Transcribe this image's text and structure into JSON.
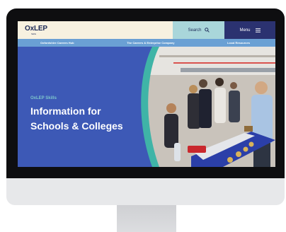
{
  "site": {
    "logo_text": "OxLEP",
    "logo_sub": "Skills"
  },
  "header": {
    "search_label": "Search",
    "menu_label": "Menu"
  },
  "subnav": {
    "items": [
      {
        "label": "Oxfordshire Careers Hub"
      },
      {
        "label": "The Careers & Enterprise Company"
      },
      {
        "label": "Local Resources"
      }
    ]
  },
  "hero": {
    "eyebrow": "OxLEP Skills",
    "title_line1": "Information for",
    "title_line2": "Schools & Colleges"
  },
  "colors": {
    "cream": "#f7f1e0",
    "teal": "#a9d6da",
    "navy": "#2b3270",
    "subnav_blue": "#6aa0d4",
    "hero_blue": "#3d59b6",
    "accent_teal": "#3fb4a7"
  },
  "icons": {
    "search": "search-icon",
    "menu": "hamburger-icon"
  }
}
